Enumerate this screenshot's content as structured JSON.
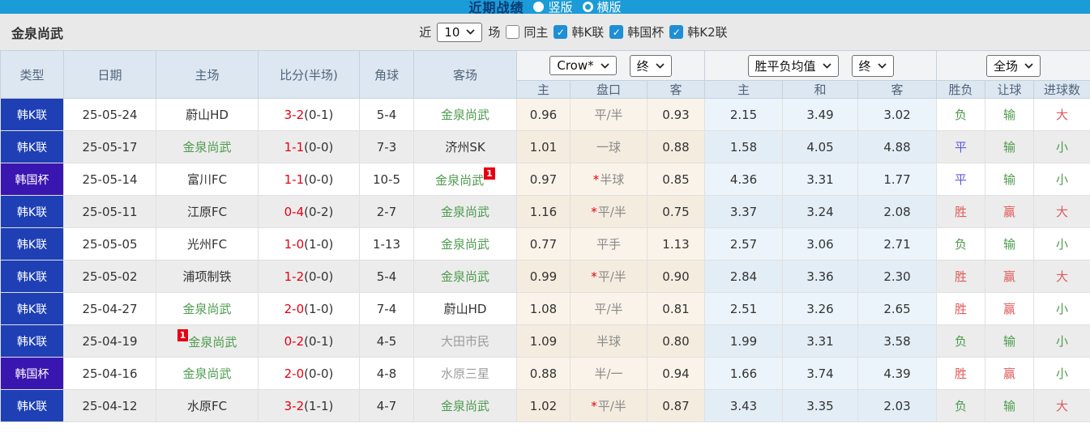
{
  "topbar": {
    "title": "近期战绩",
    "vertical_label": "竖版",
    "horizontal_label": "横版",
    "selected_layout": "竖版"
  },
  "filterbar": {
    "team": "金泉尚武",
    "near_label": "近",
    "count_value": "10",
    "games_label": "场",
    "same_home_label": "同主",
    "same_home_checked": false,
    "leagues": [
      {
        "label": "韩K联",
        "checked": true
      },
      {
        "label": "韩国杯",
        "checked": true
      },
      {
        "label": "韩K2联",
        "checked": true
      }
    ]
  },
  "table": {
    "headers": {
      "type": "类型",
      "date": "日期",
      "home": "主场",
      "score": "比分(半场)",
      "corner": "角球",
      "away": "客场"
    },
    "odds_group": {
      "bookmaker": "Crow*",
      "time": "终",
      "sub": [
        "主",
        "盘口",
        "客"
      ]
    },
    "avg_group": {
      "label": "胜平负均值",
      "time": "终",
      "sub": [
        "主",
        "和",
        "客"
      ]
    },
    "result_group": {
      "label": "全场",
      "sub": [
        "胜负",
        "让球",
        "进球数"
      ]
    },
    "rows": [
      {
        "type": "韩K联",
        "cup": false,
        "date": "25-05-24",
        "home": {
          "name": "蔚山HD",
          "cls": "dark"
        },
        "score": {
          "ft": "3-2",
          "ht": "(0-1)"
        },
        "corner": "5-4",
        "away": {
          "name": "金泉尚武",
          "cls": "green"
        },
        "odds": {
          "home": "0.96",
          "line": "平/半",
          "star": false,
          "away": "0.93"
        },
        "avg": [
          "2.15",
          "3.49",
          "3.02"
        ],
        "res": [
          {
            "t": "负",
            "c": "green"
          },
          {
            "t": "输",
            "c": "green"
          },
          {
            "t": "大",
            "c": "red"
          }
        ]
      },
      {
        "type": "韩K联",
        "cup": false,
        "date": "25-05-17",
        "home": {
          "name": "金泉尚武",
          "cls": "green"
        },
        "score": {
          "ft": "1-1",
          "ht": "(0-0)"
        },
        "corner": "7-3",
        "away": {
          "name": "济州SK",
          "cls": "dark"
        },
        "odds": {
          "home": "1.01",
          "line": "一球",
          "star": false,
          "away": "0.88"
        },
        "avg": [
          "1.58",
          "4.05",
          "4.88"
        ],
        "res": [
          {
            "t": "平",
            "c": "blue"
          },
          {
            "t": "输",
            "c": "green"
          },
          {
            "t": "小",
            "c": "green"
          }
        ]
      },
      {
        "type": "韩国杯",
        "cup": true,
        "date": "25-05-14",
        "home": {
          "name": "富川FC",
          "cls": "dark"
        },
        "score": {
          "ft": "1-1",
          "ht": "(0-0)"
        },
        "corner": "10-5",
        "away": {
          "name": "金泉尚武",
          "cls": "green",
          "badge": "1",
          "badge_pos": "after"
        },
        "odds": {
          "home": "0.97",
          "line": "半球",
          "star": true,
          "away": "0.85"
        },
        "avg": [
          "4.36",
          "3.31",
          "1.77"
        ],
        "res": [
          {
            "t": "平",
            "c": "blue"
          },
          {
            "t": "输",
            "c": "green"
          },
          {
            "t": "小",
            "c": "green"
          }
        ]
      },
      {
        "type": "韩K联",
        "cup": false,
        "date": "25-05-11",
        "home": {
          "name": "江原FC",
          "cls": "dark"
        },
        "score": {
          "ft": "0-4",
          "ht": "(0-2)"
        },
        "corner": "2-7",
        "away": {
          "name": "金泉尚武",
          "cls": "green"
        },
        "odds": {
          "home": "1.16",
          "line": "平/半",
          "star": true,
          "away": "0.75"
        },
        "avg": [
          "3.37",
          "3.24",
          "2.08"
        ],
        "res": [
          {
            "t": "胜",
            "c": "red"
          },
          {
            "t": "赢",
            "c": "red"
          },
          {
            "t": "大",
            "c": "red"
          }
        ]
      },
      {
        "type": "韩K联",
        "cup": false,
        "date": "25-05-05",
        "home": {
          "name": "光州FC",
          "cls": "dark"
        },
        "score": {
          "ft": "1-0",
          "ht": "(1-0)"
        },
        "corner": "1-13",
        "away": {
          "name": "金泉尚武",
          "cls": "green"
        },
        "odds": {
          "home": "0.77",
          "line": "平手",
          "star": false,
          "away": "1.13"
        },
        "avg": [
          "2.57",
          "3.06",
          "2.71"
        ],
        "res": [
          {
            "t": "负",
            "c": "green"
          },
          {
            "t": "输",
            "c": "green"
          },
          {
            "t": "小",
            "c": "green"
          }
        ]
      },
      {
        "type": "韩K联",
        "cup": false,
        "date": "25-05-02",
        "home": {
          "name": "浦项制铁",
          "cls": "dark"
        },
        "score": {
          "ft": "1-2",
          "ht": "(0-0)"
        },
        "corner": "5-4",
        "away": {
          "name": "金泉尚武",
          "cls": "green"
        },
        "odds": {
          "home": "0.99",
          "line": "平/半",
          "star": true,
          "away": "0.90"
        },
        "avg": [
          "2.84",
          "3.36",
          "2.30"
        ],
        "res": [
          {
            "t": "胜",
            "c": "red"
          },
          {
            "t": "赢",
            "c": "red"
          },
          {
            "t": "大",
            "c": "red"
          }
        ]
      },
      {
        "type": "韩K联",
        "cup": false,
        "date": "25-04-27",
        "home": {
          "name": "金泉尚武",
          "cls": "green"
        },
        "score": {
          "ft": "2-0",
          "ht": "(1-0)"
        },
        "corner": "7-4",
        "away": {
          "name": "蔚山HD",
          "cls": "dark"
        },
        "odds": {
          "home": "1.08",
          "line": "平/半",
          "star": false,
          "away": "0.81"
        },
        "avg": [
          "2.51",
          "3.26",
          "2.65"
        ],
        "res": [
          {
            "t": "胜",
            "c": "red"
          },
          {
            "t": "赢",
            "c": "red"
          },
          {
            "t": "小",
            "c": "green"
          }
        ]
      },
      {
        "type": "韩K联",
        "cup": false,
        "date": "25-04-19",
        "home": {
          "name": "金泉尚武",
          "cls": "green",
          "badge": "1",
          "badge_pos": "before"
        },
        "score": {
          "ft": "0-2",
          "ht": "(0-1)"
        },
        "corner": "4-5",
        "away": {
          "name": "大田市民",
          "cls": "gray"
        },
        "odds": {
          "home": "1.09",
          "line": "半球",
          "star": false,
          "away": "0.80"
        },
        "avg": [
          "1.99",
          "3.31",
          "3.58"
        ],
        "res": [
          {
            "t": "负",
            "c": "green"
          },
          {
            "t": "输",
            "c": "green"
          },
          {
            "t": "小",
            "c": "green"
          }
        ]
      },
      {
        "type": "韩国杯",
        "cup": true,
        "date": "25-04-16",
        "home": {
          "name": "金泉尚武",
          "cls": "green"
        },
        "score": {
          "ft": "2-0",
          "ht": "(0-0)"
        },
        "corner": "4-8",
        "away": {
          "name": "水原三星",
          "cls": "gray"
        },
        "odds": {
          "home": "0.88",
          "line": "半/一",
          "star": false,
          "away": "0.94"
        },
        "avg": [
          "1.66",
          "3.74",
          "4.39"
        ],
        "res": [
          {
            "t": "胜",
            "c": "red"
          },
          {
            "t": "赢",
            "c": "red"
          },
          {
            "t": "小",
            "c": "green"
          }
        ]
      },
      {
        "type": "韩K联",
        "cup": false,
        "date": "25-04-12",
        "home": {
          "name": "水原FC",
          "cls": "dark"
        },
        "score": {
          "ft": "3-2",
          "ht": "(1-1)"
        },
        "corner": "4-7",
        "away": {
          "name": "金泉尚武",
          "cls": "green"
        },
        "odds": {
          "home": "1.02",
          "line": "平/半",
          "star": true,
          "away": "0.87"
        },
        "avg": [
          "3.43",
          "3.35",
          "2.03"
        ],
        "res": [
          {
            "t": "负",
            "c": "green"
          },
          {
            "t": "输",
            "c": "green"
          },
          {
            "t": "大",
            "c": "red"
          }
        ]
      }
    ]
  },
  "colors": {
    "topbar_blue": "#1b9bd7",
    "title_navy": "#0a3a73",
    "league_badge_blue": "#1e40b4",
    "cup_badge_indigo": "#3a16b0",
    "score_red": "#e60012",
    "focus_team_green": "#4d9b4d",
    "result_red": "#e05a5a",
    "result_green": "#4d9b4d",
    "result_blue": "#5b5be0",
    "odds_cream_bg": "#faf3e9",
    "avg_blue_bg": "#ebf4fa",
    "header_bg": "#dde7f1"
  }
}
